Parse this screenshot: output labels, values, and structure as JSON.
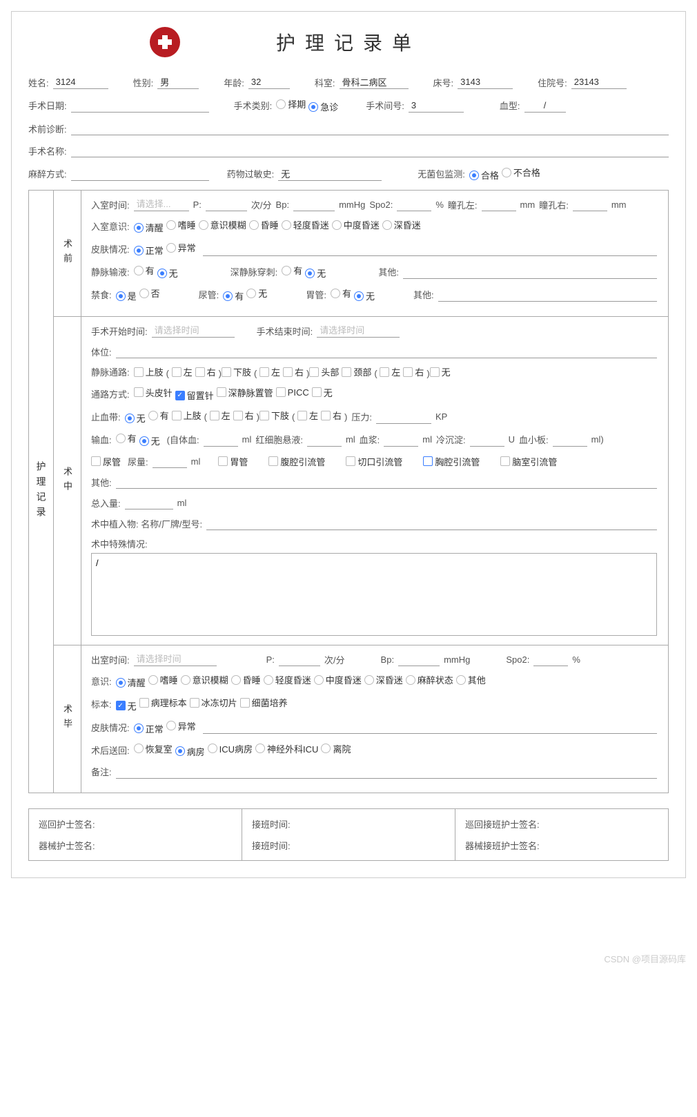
{
  "title": "护理记录单",
  "header": {
    "name_lbl": "姓名:",
    "name": "3124",
    "sex_lbl": "性别:",
    "sex": "男",
    "age_lbl": "年龄:",
    "age": "32",
    "dept_lbl": "科室:",
    "dept": "骨科二病区",
    "bed_lbl": "床号:",
    "bed": "3143",
    "adm_lbl": "住院号:",
    "adm": "23143",
    "opdate_lbl": "手术日期:",
    "opdate": "",
    "optype_lbl": "手术类别:",
    "optype_opts": [
      "择期",
      "急诊"
    ],
    "optype_sel": 1,
    "room_lbl": "手术间号:",
    "room": "3",
    "blood_lbl": "血型:",
    "blood": "/",
    "preop_lbl": "术前诊断:",
    "preop": "",
    "opname_lbl": "手术名称:",
    "opname": "",
    "anes_lbl": "麻醉方式:",
    "anes": "",
    "allergy_lbl": "药物过敏史:",
    "allergy": "无",
    "pkg_lbl": "无菌包监测:",
    "pkg_opts": [
      "合格",
      "不合格"
    ],
    "pkg_sel": 0
  },
  "record_lbl": "护理记录",
  "pre": {
    "lbl": "术前",
    "entry_time_lbl": "入室时间:",
    "entry_time_ph": "请选择...",
    "p_lbl": "P:",
    "p_unit": "次/分",
    "bp_lbl": "Bp:",
    "bp_unit": "mmHg",
    "spo2_lbl": "Spo2:",
    "spo2_unit": "%",
    "pupilL_lbl": "瞳孔左:",
    "pupilR_lbl": "瞳孔右:",
    "mm": "mm",
    "consc_lbl": "入室意识:",
    "consc_opts": [
      "清醒",
      "嗜睡",
      "意识模糊",
      "昏睡",
      "轻度昏迷",
      "中度昏迷",
      "深昏迷"
    ],
    "consc_sel": 0,
    "skin_lbl": "皮肤情况:",
    "skin_opts": [
      "正常",
      "异常"
    ],
    "skin_sel": 0,
    "iv_lbl": "静脉输液:",
    "iv_opts": [
      "有",
      "无"
    ],
    "iv_sel": 1,
    "dvp_lbl": "深静脉穿刺:",
    "dvp_opts": [
      "有",
      "无"
    ],
    "dvp_sel": 1,
    "other1_lbl": "其他:",
    "fast_lbl": "禁食:",
    "fast_opts": [
      "是",
      "否"
    ],
    "fast_sel": 0,
    "cath_lbl": "尿管:",
    "cath_opts": [
      "有",
      "无"
    ],
    "cath_sel": 0,
    "gast_lbl": "胃管:",
    "gast_opts": [
      "有",
      "无"
    ],
    "gast_sel": 1,
    "other2_lbl": "其他:"
  },
  "mid": {
    "lbl": "术中",
    "start_lbl": "手术开始时间:",
    "start_ph": "请选择时间",
    "end_lbl": "手术结束时间:",
    "end_ph": "请选择时间",
    "pos_lbl": "体位:",
    "vein_lbl": "静脉通路:",
    "vein_opts": [
      "上肢",
      "( ",
      "左",
      "右",
      ")",
      "下肢",
      "( ",
      "左",
      "右",
      ")",
      "头部",
      "颈部",
      "( ",
      "左",
      "右",
      ")",
      "无"
    ],
    "access_lbl": "通路方式:",
    "access_opts": [
      "头皮针",
      "留置针",
      "深静脉置管",
      "PICC",
      "无"
    ],
    "access_sel": [
      1
    ],
    "tourn_lbl": "止血带:",
    "tourn_opts": [
      "无",
      "有",
      "上肢",
      "( ",
      "左",
      "右",
      ")",
      "下肢",
      "( ",
      "左",
      "右",
      ")"
    ],
    "tourn_sel": 0,
    "press_lbl": "压力:",
    "press_unit": "KP",
    "trans_lbl": "输血:",
    "trans_opts": [
      "有",
      "无"
    ],
    "trans_sel": 1,
    "trans_auto": "(自体血:",
    "ml": "ml",
    "rbc_lbl": "红细胞悬液:",
    "plasma_lbl": "血浆:",
    "cryo_lbl": "冷沉淀:",
    "u": "U",
    "plate_lbl": "血小板:",
    "close": "ml)",
    "drain_opts": [
      "尿管",
      "胃管",
      "腹腔引流管",
      "切口引流管",
      "胸腔引流管",
      "脑室引流管"
    ],
    "drain_part": [
      4
    ],
    "urine_lbl": "尿量:",
    "other_lbl": "其他:",
    "total_lbl": "总入量:",
    "implant_lbl": "术中植入物: 名称/厂牌/型号:",
    "special_lbl": "术中特殊情况:",
    "special_val": "/"
  },
  "post": {
    "lbl": "术毕",
    "exit_lbl": "出室时间:",
    "exit_ph": "请选择时间",
    "p_lbl": "P:",
    "p_unit": "次/分",
    "bp_lbl": "Bp:",
    "bp_unit": "mmHg",
    "spo2_lbl": "Spo2:",
    "spo2_unit": "%",
    "consc_lbl": "意识:",
    "consc_opts": [
      "清醒",
      "嗜睡",
      "意识模糊",
      "昏睡",
      "轻度昏迷",
      "中度昏迷",
      "深昏迷",
      "麻醉状态",
      "其他"
    ],
    "consc_sel": 0,
    "spec_lbl": "标本:",
    "spec_opts": [
      "无",
      "病理标本",
      "冰冻切片",
      "细菌培养"
    ],
    "spec_sel": [
      0
    ],
    "skin_lbl": "皮肤情况:",
    "skin_opts": [
      "正常",
      "异常"
    ],
    "skin_sel": 0,
    "dest_lbl": "术后送回:",
    "dest_opts": [
      "恢复室",
      "病房",
      "ICU病房",
      "神经外科ICU",
      "离院"
    ],
    "dest_sel": 1,
    "note_lbl": "备注:"
  },
  "sig": {
    "circ": "巡回护士签名:",
    "inst": "器械护士签名:",
    "shift1": "接班时间:",
    "shift2": "接班时间:",
    "circ2": "巡回接班护士签名:",
    "inst2": "器械接班护士签名:"
  },
  "watermark": "CSDN @项目源码库"
}
